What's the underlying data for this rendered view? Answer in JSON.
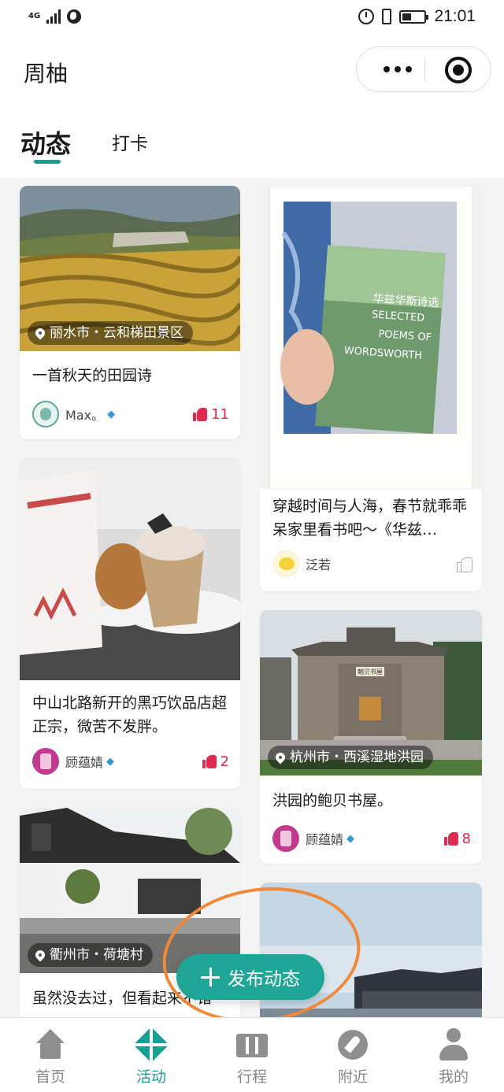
{
  "status_bar": {
    "network": "4G",
    "time": "21:01"
  },
  "header": {
    "title": "周柚"
  },
  "tabs": [
    {
      "label": "动态",
      "active": true
    },
    {
      "label": "打卡",
      "active": false
    }
  ],
  "posts": [
    {
      "location": "丽水市・云和梯田景区",
      "text": "一首秋天的田园诗",
      "user": "Max。",
      "likes": "11",
      "liked": true
    },
    {
      "location": "",
      "text": "穿越时间与人海，春节就乖乖呆家里看书吧～《华兹…",
      "user": "泛若",
      "likes": "",
      "liked": false,
      "image_text": "华兹华斯诗选"
    },
    {
      "location": "",
      "text": "中山北路新开的黑巧饮品店超正宗，微苦不发胖。",
      "user": "顾蕴婧",
      "likes": "2",
      "liked": true
    },
    {
      "location": "杭州市・西溪湿地洪园",
      "text": "洪园的鲍贝书屋。",
      "user": "顾蕴婧",
      "likes": "8",
      "liked": true,
      "image_text": "鲍贝书屋"
    },
    {
      "location": "衢州市・荷塘村",
      "text": "虽然没去过，但看起来不错",
      "user": "",
      "likes": ""
    },
    {
      "location": "",
      "text": "",
      "user": "",
      "likes": ""
    }
  ],
  "publish_button": {
    "label": "发布动态"
  },
  "bottom_nav": [
    {
      "label": "首页",
      "icon": "home-icon"
    },
    {
      "label": "活动",
      "icon": "activity-icon",
      "active": true
    },
    {
      "label": "行程",
      "icon": "itinerary-icon"
    },
    {
      "label": "附近",
      "icon": "nearby-icon"
    },
    {
      "label": "我的",
      "icon": "profile-icon"
    }
  ],
  "colors": {
    "accent": "#1a9e94",
    "like": "#e02b50",
    "annotation": "#f08a3a",
    "publish": "#20a697"
  }
}
